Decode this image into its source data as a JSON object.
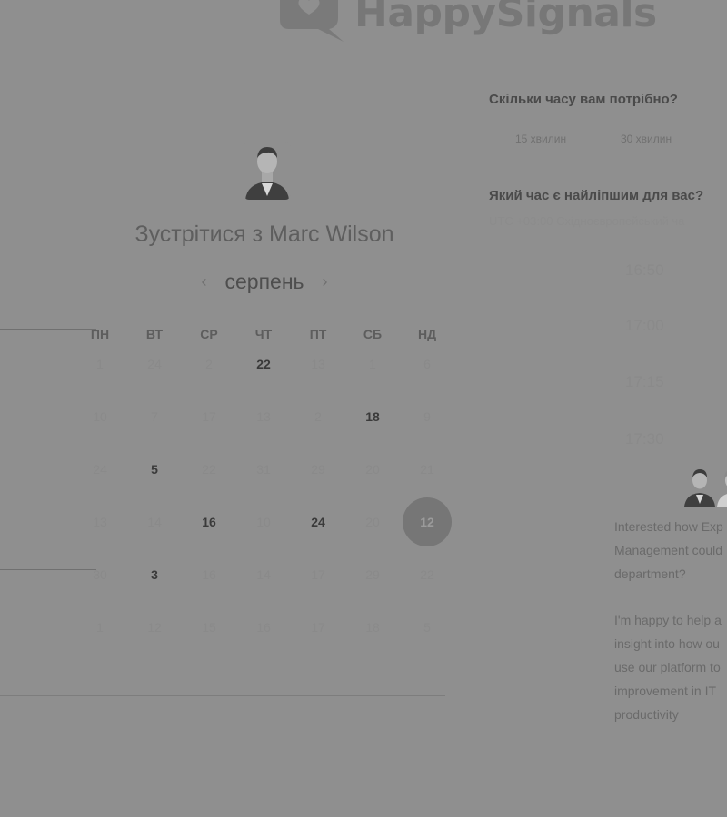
{
  "brand": {
    "name": "HappySignals"
  },
  "scheduler": {
    "title": "Зустрітися з Marc Wilson",
    "month": "серпень",
    "weekdays": [
      "ПН",
      "ВТ",
      "СР",
      "ЧТ",
      "ПТ",
      "СБ",
      "НД"
    ],
    "weeks": [
      [
        "1",
        "24",
        "2",
        "22",
        "13",
        "1",
        "6"
      ],
      [
        "10",
        "7",
        "17",
        "13",
        "2",
        "18",
        "9"
      ],
      [
        "24",
        "5",
        "22",
        "31",
        "29",
        "20",
        "21"
      ],
      [
        "13",
        "14",
        "16",
        "10",
        "24",
        "20",
        "12"
      ],
      [
        "30",
        "3",
        "16",
        "14",
        "17",
        "29",
        "22"
      ],
      [
        "1",
        "12",
        "15",
        "16",
        "17",
        "18",
        "5"
      ]
    ],
    "available_dates": [
      "22",
      "18",
      "5",
      "16",
      "24",
      "3"
    ],
    "selected_date": "12"
  },
  "duration": {
    "question": "Скільки часу вам потрібно?",
    "options": [
      "15 хвилин",
      "30 хвилин"
    ]
  },
  "time": {
    "question": "Який час є найліпшим для вас?",
    "timezone": "UTC +03:00 Східноєвропейський ча",
    "slots": [
      "16:50",
      "17:00",
      "17:15",
      "17:30"
    ]
  },
  "description": {
    "lines": [
      "Interested how Exp",
      "Management could",
      "department?",
      "",
      "I'm happy to help a",
      "insight into how ou",
      "use our platform to",
      "improvement in IT",
      "productivity"
    ]
  }
}
